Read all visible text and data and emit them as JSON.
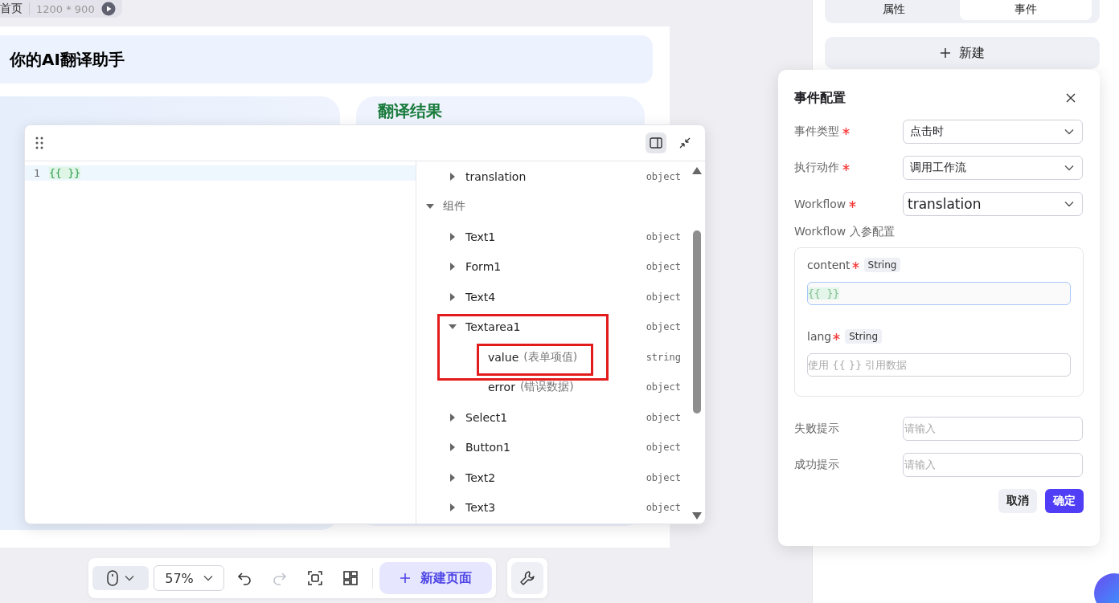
{
  "breadcrumb": {
    "page": "首页",
    "size": "1200 * 900"
  },
  "canvas": {
    "title": "你的AI翻译助手",
    "result_heading": "翻译结果"
  },
  "code_editor": {
    "lines": [
      {
        "number": "1",
        "code": "{{ }}"
      }
    ],
    "sidebar_open": true
  },
  "data_tree": [
    {
      "kind": "field",
      "label": "translation",
      "type": "object",
      "expanded": false,
      "highlighted": false
    },
    {
      "kind": "group",
      "label": "组件",
      "expanded": true,
      "highlighted": false,
      "children": [
        {
          "kind": "field",
          "label": "Text1",
          "type": "object",
          "expanded": false,
          "highlighted": false
        },
        {
          "kind": "field",
          "label": "Form1",
          "type": "object",
          "expanded": false,
          "highlighted": false
        },
        {
          "kind": "field",
          "label": "Text4",
          "type": "object",
          "expanded": false,
          "highlighted": false
        },
        {
          "kind": "field",
          "label": "Textarea1",
          "type": "object",
          "expanded": true,
          "highlighted": true,
          "children": [
            {
              "kind": "field",
              "label": "value",
              "note": "(表单项值)",
              "type": "string",
              "highlighted": true
            },
            {
              "kind": "field",
              "label": "error",
              "note": "(错误数据)",
              "type": "object",
              "highlighted": false
            }
          ]
        },
        {
          "kind": "field",
          "label": "Select1",
          "type": "object",
          "expanded": false,
          "highlighted": false
        },
        {
          "kind": "field",
          "label": "Button1",
          "type": "object",
          "expanded": false,
          "highlighted": false
        },
        {
          "kind": "field",
          "label": "Text2",
          "type": "object",
          "expanded": false,
          "highlighted": false
        },
        {
          "kind": "field",
          "label": "Text3",
          "type": "object",
          "expanded": false,
          "highlighted": false
        }
      ]
    }
  ],
  "toolbar": {
    "zoom": "57%",
    "redo_disabled": true,
    "new_page": "新建页面"
  },
  "panel": {
    "tabs": [
      {
        "label": "属性",
        "selected": false
      },
      {
        "label": "事件",
        "selected": true
      }
    ],
    "new_button": "新建"
  },
  "event_config": {
    "title": "事件配置",
    "fields": [
      {
        "label": "事件类型",
        "required": true,
        "value": "点击时",
        "kind": "select"
      },
      {
        "label": "执行动作",
        "required": true,
        "value": "调用工作流",
        "kind": "select"
      },
      {
        "label": "Workflow",
        "required": true,
        "value": "translation",
        "kind": "workflow"
      }
    ],
    "params_label": "Workflow 入参配置",
    "params": [
      {
        "name": "content",
        "required": true,
        "type": "String",
        "value": "{{ }}",
        "focused": true
      },
      {
        "name": "lang",
        "required": true,
        "type": "String",
        "placeholder": "使用 {{ }} 引用数据",
        "focused": false
      }
    ],
    "messages": [
      {
        "label": "失败提示",
        "placeholder": "请输入"
      },
      {
        "label": "成功提示",
        "placeholder": "请输入"
      }
    ],
    "buttons": [
      {
        "label": "取消",
        "kind": "secondary"
      },
      {
        "label": "确定",
        "kind": "primary"
      }
    ]
  }
}
